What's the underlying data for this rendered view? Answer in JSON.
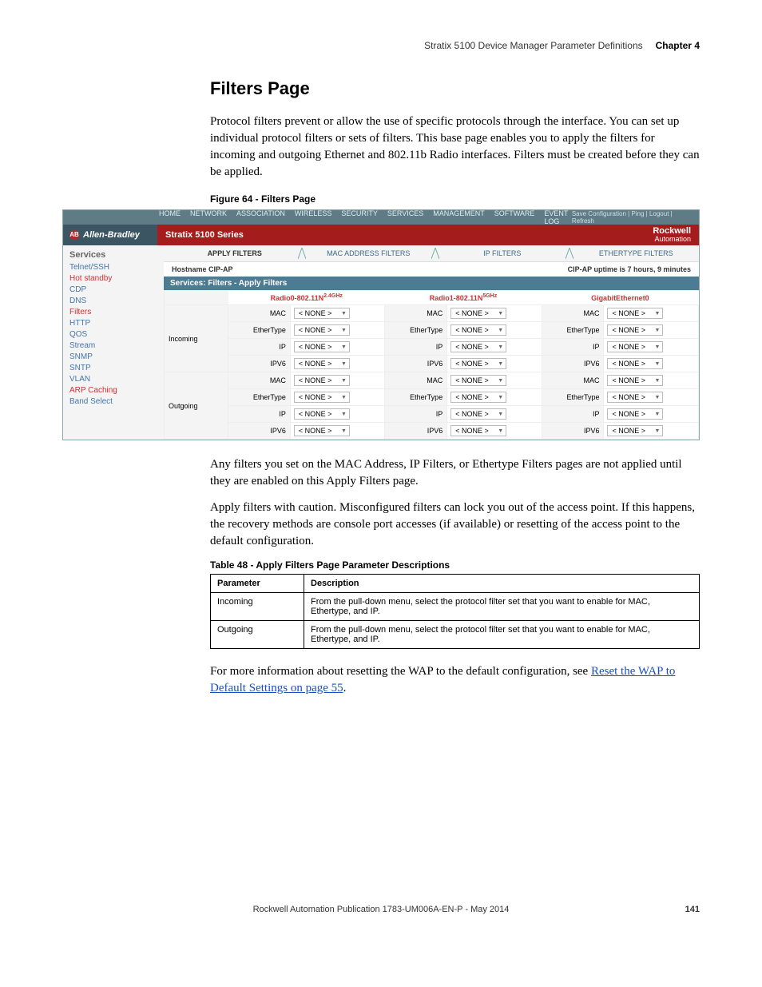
{
  "header": {
    "breadcrumb": "Stratix 5100 Device Manager Parameter Definitions",
    "chapter": "Chapter 4"
  },
  "heading": "Filters Page",
  "paragraphs": {
    "p1": "Protocol filters prevent or allow the use of specific protocols through the interface. You can set up individual protocol filters or sets of filters. This base page enables you to apply the filters for incoming and outgoing Ethernet and 802.11b Radio interfaces. Filters must be created before they can be applied.",
    "p2": "Any filters you set on the MAC Address, IP Filters, or Ethertype Filters pages are not applied until they are enabled on this Apply Filters page.",
    "p3": "Apply filters with caution. Misconfigured filters can lock you out of the access point. If this happens, the recovery methods are console port accesses (if available) or resetting of the access point to the default configuration.",
    "p4_prefix": "For more information about resetting the WAP to the default configuration, see ",
    "p4_link": "Reset the WAP to Default Settings on page 55",
    "p4_suffix": "."
  },
  "figure": {
    "caption": "Figure 64 - Filters Page",
    "toplinks": "Save Configuration   |   Ping   |   Logout   |   Refresh",
    "toptabs": [
      "HOME",
      "NETWORK",
      "ASSOCIATION",
      "WIRELESS",
      "SECURITY",
      "SERVICES",
      "MANAGEMENT",
      "SOFTWARE",
      "EVENT LOG"
    ],
    "brand_left": "Allen-Bradley",
    "brand_mid": "Stratix 5100 Series",
    "brand_right_main": "Rockwell",
    "brand_right_sub": "Automation",
    "side_title": "Services",
    "side_links": [
      {
        "label": "Telnet/SSH",
        "cls": "link-std",
        "name": "side-link-telnet-ssh"
      },
      {
        "label": "Hot standby",
        "cls": "link-hl",
        "name": "side-link-hot-standby"
      },
      {
        "label": "CDP",
        "cls": "link-std",
        "name": "side-link-cdp"
      },
      {
        "label": "DNS",
        "cls": "link-std",
        "name": "side-link-dns"
      },
      {
        "label": "Filters",
        "cls": "link-hl",
        "name": "side-link-filters"
      },
      {
        "label": "HTTP",
        "cls": "link-std",
        "name": "side-link-http"
      },
      {
        "label": "QOS",
        "cls": "link-std",
        "name": "side-link-qos"
      },
      {
        "label": "Stream",
        "cls": "link-std",
        "name": "side-link-stream"
      },
      {
        "label": "SNMP",
        "cls": "link-std",
        "name": "side-link-snmp"
      },
      {
        "label": "SNTP",
        "cls": "link-std",
        "name": "side-link-sntp"
      },
      {
        "label": "VLAN",
        "cls": "link-std",
        "name": "side-link-vlan"
      },
      {
        "label": "ARP Caching",
        "cls": "link-hl",
        "name": "side-link-arp-caching"
      },
      {
        "label": "Band Select",
        "cls": "link-std",
        "name": "side-link-band-select"
      }
    ],
    "subtabs": [
      "APPLY FILTERS",
      "MAC ADDRESS FILTERS",
      "IP FILTERS",
      "ETHERTYPE FILTERS"
    ],
    "hostname_label": "Hostname  CIP-AP",
    "uptime": "CIP-AP uptime is 7 hours, 9 minutes",
    "section_title": "Services: Filters - Apply Filters",
    "iface_headers": {
      "i0_base": "Radio0-802.11N",
      "i0_sup": "2.4GHz",
      "i1_base": "Radio1-802.11N",
      "i1_sup": "5GHz",
      "i2": "GigabitEthernet0"
    },
    "directions": {
      "incoming": "Incoming",
      "outgoing": "Outgoing"
    },
    "ftypes": [
      "MAC",
      "EtherType",
      "IP",
      "IPV6"
    ],
    "none_value": "< NONE >"
  },
  "table48": {
    "caption": "Table 48 - Apply Filters Page Parameter Descriptions",
    "head_param": "Parameter",
    "head_desc": "Description",
    "rows": [
      {
        "param": "Incoming",
        "desc": "From the pull-down menu, select the protocol filter set that you want to enable for MAC, Ethertype, and IP."
      },
      {
        "param": "Outgoing",
        "desc": "From the pull-down menu, select the protocol filter set that you want to enable for MAC, Ethertype, and IP."
      }
    ]
  },
  "footer": {
    "pub": "Rockwell Automation Publication 1783-UM006A-EN-P - May 2014",
    "page": "141"
  }
}
